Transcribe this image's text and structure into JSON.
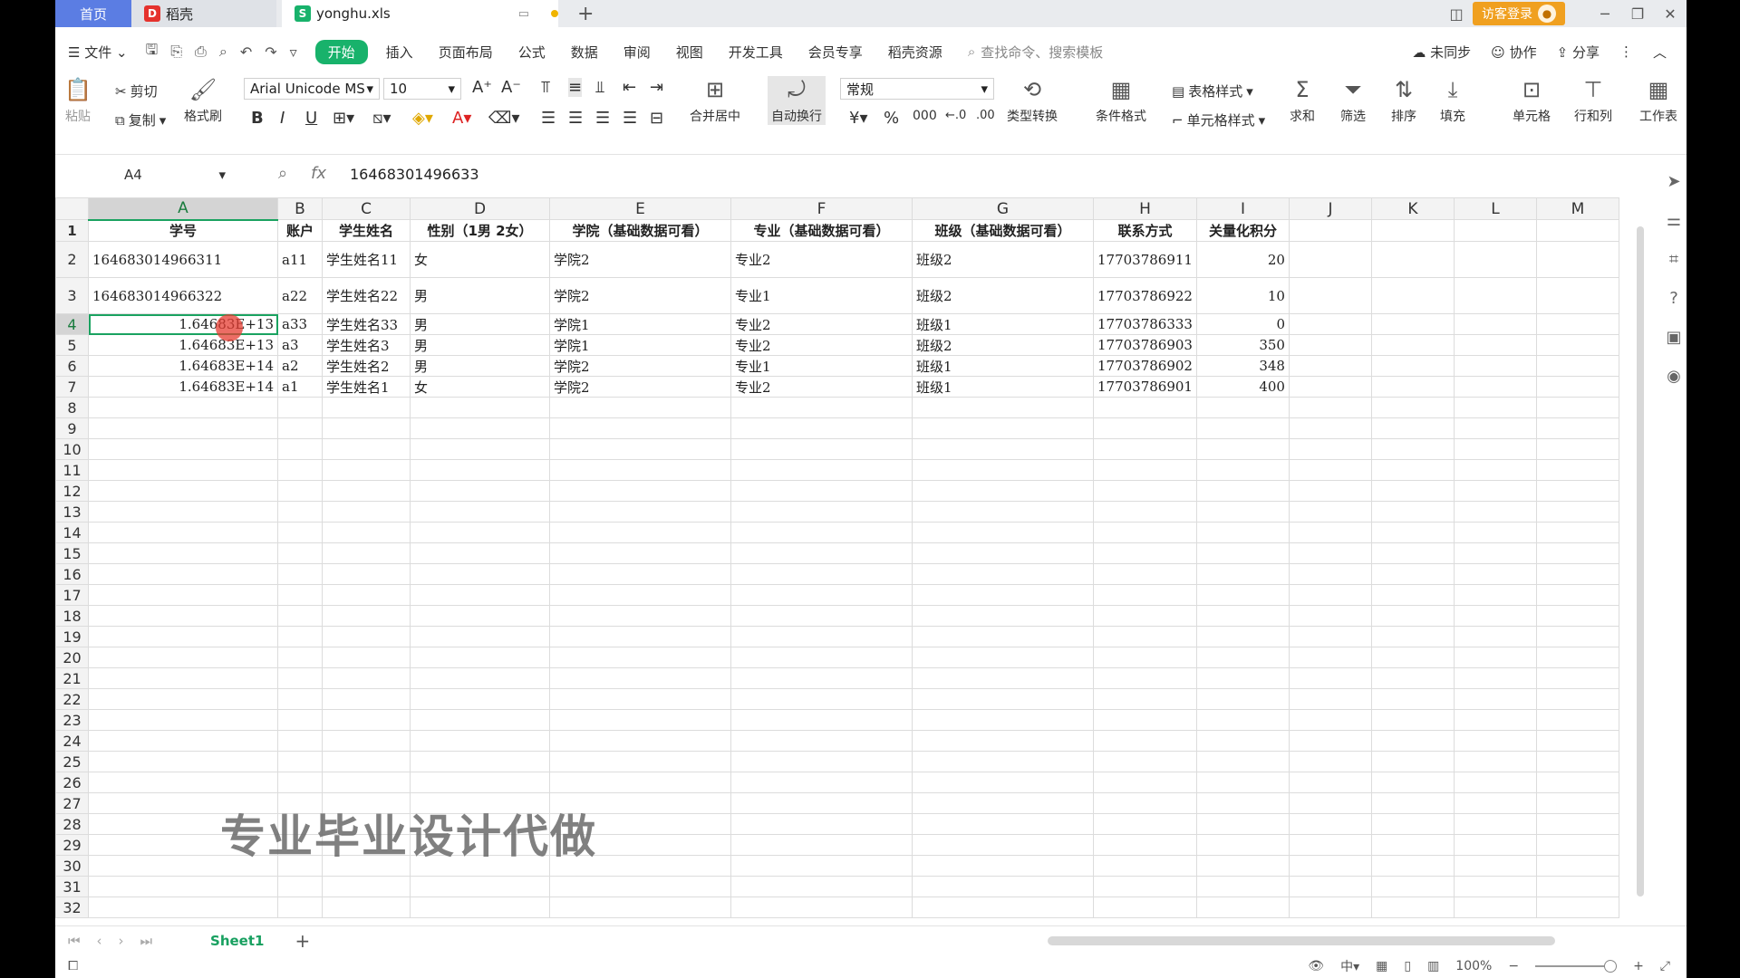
{
  "titlebar": {
    "home_tab": "首页",
    "docer_tab": "稻壳",
    "file_tab": "yonghu.xls",
    "login_button": "访客登录"
  },
  "menubar": {
    "file_menu": "文件",
    "tabs": [
      "开始",
      "插入",
      "页面布局",
      "公式",
      "数据",
      "审阅",
      "视图",
      "开发工具",
      "会员专享",
      "稻壳资源"
    ],
    "active_tab": "开始",
    "search_placeholder": "查找命令、搜索模板",
    "sync": "未同步",
    "collab": "协作",
    "share": "分享"
  },
  "ribbon": {
    "paste": "粘贴",
    "cut": "剪切",
    "copy": "复制",
    "format_painter": "格式刷",
    "font_name": "Arial Unicode MS",
    "font_size": "10",
    "merge_center": "合并居中",
    "wrap_text": "自动换行",
    "number_format": "常规",
    "type_convert": "类型转换",
    "conditional_format": "条件格式",
    "table_style": "表格样式",
    "cell_style": "单元格样式",
    "sum": "求和",
    "filter": "筛选",
    "sort": "排序",
    "fill": "填充",
    "cell": "单元格",
    "row_col": "行和列",
    "worksheet": "工作表"
  },
  "formula_bar": {
    "name_box": "A4",
    "fx": "fx",
    "value": "16468301496633"
  },
  "grid": {
    "columns": [
      "A",
      "B",
      "C",
      "D",
      "E",
      "F",
      "G",
      "H",
      "I",
      "J",
      "K",
      "L",
      "M"
    ],
    "header_row": [
      "学号",
      "账户",
      "学生姓名",
      "性别（1男 2女）",
      "学院（基础数据可看）",
      "专业（基础数据可看）",
      "班级（基础数据可看）",
      "联系方式",
      "关量化积分"
    ],
    "rows": [
      [
        "164683014966311",
        "a11",
        "学生姓名11",
        "女",
        "学院2",
        "专业2",
        "班级2",
        "17703786911",
        "20"
      ],
      [
        "164683014966322",
        "a22",
        "学生姓名22",
        "男",
        "学院2",
        "专业1",
        "班级2",
        "17703786922",
        "10"
      ],
      [
        "1.64683E+13",
        "a33",
        "学生姓名33",
        "男",
        "学院1",
        "专业2",
        "班级1",
        "17703786333",
        "0"
      ],
      [
        "1.64683E+13",
        "a3",
        "学生姓名3",
        "男",
        "学院1",
        "专业2",
        "班级2",
        "17703786903",
        "350"
      ],
      [
        "1.64683E+14",
        "a2",
        "学生姓名2",
        "男",
        "学院2",
        "专业1",
        "班级1",
        "17703786902",
        "348"
      ],
      [
        "1.64683E+14",
        "a1",
        "学生姓名1",
        "女",
        "学院2",
        "专业2",
        "班级1",
        "17703786901",
        "400"
      ]
    ],
    "row_numbers": [
      "1",
      "2",
      "3",
      "4",
      "5",
      "6",
      "7",
      "8",
      "9",
      "10",
      "11",
      "12",
      "13",
      "14",
      "15",
      "16",
      "17",
      "18",
      "19",
      "20",
      "21",
      "22",
      "23",
      "24",
      "25",
      "26",
      "27",
      "28",
      "29",
      "30",
      "31",
      "32"
    ]
  },
  "watermark": "专业毕业设计代做",
  "sheets": {
    "active": "Sheet1"
  },
  "status": {
    "zoom": "100%"
  },
  "colors": {
    "accent_green": "#18b26b",
    "home_tab_blue": "#5b7de3",
    "login_orange": "#f0a020"
  }
}
